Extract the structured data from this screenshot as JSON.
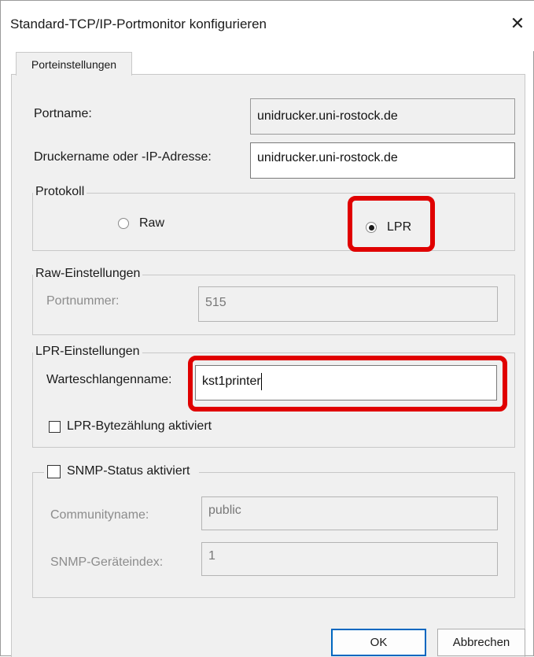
{
  "window": {
    "title": "Standard-TCP/IP-Portmonitor konfigurieren"
  },
  "tab": {
    "label": "Porteinstellungen"
  },
  "port": {
    "portname_label": "Portname:",
    "portname_value": "unidrucker.uni-rostock.de",
    "host_label": "Druckername oder -IP-Adresse:",
    "host_value": "unidrucker.uni-rostock.de"
  },
  "protocol": {
    "legend": "Protokoll",
    "raw_label": "Raw",
    "lpr_label": "LPR",
    "selected": "LPR"
  },
  "raw_settings": {
    "legend": "Raw-Einstellungen",
    "port_number_label": "Portnummer:",
    "port_number_value": "515"
  },
  "lpr_settings": {
    "legend": "LPR-Einstellungen",
    "queue_label": "Warteschlangenname:",
    "queue_value": "kst1printer",
    "byte_count_label": "LPR-Bytezählung aktiviert",
    "byte_count_checked": false
  },
  "snmp": {
    "legend": "SNMP-Status aktiviert",
    "enabled": false,
    "community_label": "Communityname:",
    "community_value": "public",
    "device_index_label": "SNMP-Geräteindex:",
    "device_index_value": "1"
  },
  "buttons": {
    "ok": "OK",
    "cancel": "Abbrechen"
  },
  "colors": {
    "highlight": "#e00000",
    "default_button_border": "#0067c0"
  }
}
